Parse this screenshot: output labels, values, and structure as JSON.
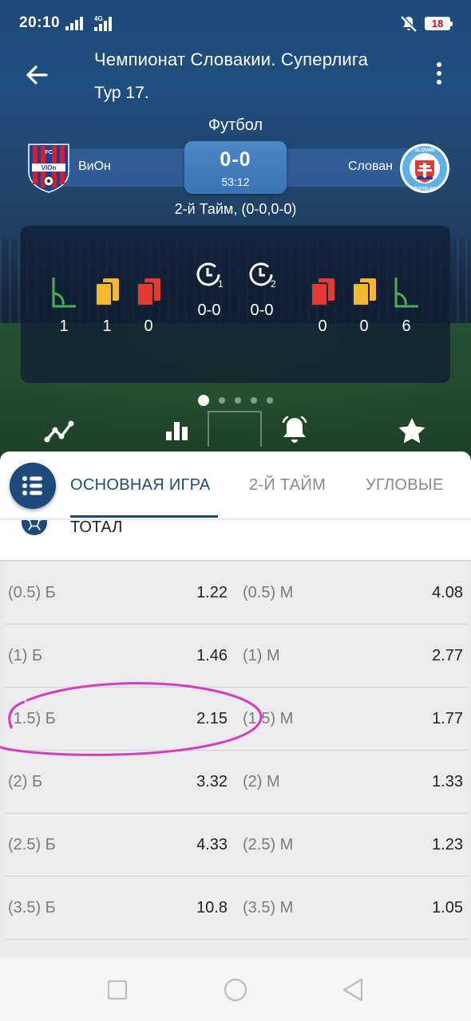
{
  "status_bar": {
    "time": "20:10",
    "network": "4G",
    "battery": "18",
    "battery_color": "#d0021b"
  },
  "header": {
    "back_icon": "arrow-left-icon",
    "title": "Чемпионат Словакии. Суперлига",
    "subtitle": "Тур 17.",
    "more_icon": "more-vertical-icon"
  },
  "match": {
    "sport": "Футбол",
    "home_team": "ВиОн",
    "away_team": "Слован",
    "home_logo_text": "FC ViOn",
    "away_logo_text": "SLOVAN BRATISLAVA",
    "score": "0-0",
    "time": "53:12",
    "half_info": "2-й Тайм, (0-0,0-0)"
  },
  "stats": {
    "home": {
      "corners": "1",
      "yellow_cards": "1",
      "red_cards": "0"
    },
    "away": {
      "red_cards": "0",
      "yellow_cards": "0",
      "corners": "6"
    },
    "periods": [
      {
        "label": "1",
        "score": "0-0"
      },
      {
        "label": "2",
        "score": "0-0"
      }
    ],
    "corner_color": "#4caf50",
    "yellow_color": "#f5b82e",
    "red_color": "#e53935"
  },
  "pager": {
    "count": 5,
    "active": 0
  },
  "actions": [
    "line-chart-icon",
    "bar-chart-icon",
    "bell-icon",
    "star-icon"
  ],
  "tabs": [
    {
      "label": "ОСНОВНАЯ ИГРА",
      "active": true
    },
    {
      "label": "2-Й ТАЙМ",
      "active": false
    },
    {
      "label": "УГЛОВЫЕ",
      "active": false
    }
  ],
  "market": {
    "title": "ТОТАЛ",
    "icon": "soccer-ball-icon",
    "rows": [
      {
        "over_label": "(0.5) Б",
        "over_odd": "1.22",
        "under_label": "(0.5) М",
        "under_odd": "4.08"
      },
      {
        "over_label": "(1) Б",
        "over_odd": "1.46",
        "under_label": "(1) М",
        "under_odd": "2.77"
      },
      {
        "over_label": "(1.5) Б",
        "over_odd": "2.15",
        "under_label": "(1.5) М",
        "under_odd": "1.77"
      },
      {
        "over_label": "(2) Б",
        "over_odd": "3.32",
        "under_label": "(2) М",
        "under_odd": "1.33"
      },
      {
        "over_label": "(2.5) Б",
        "over_odd": "4.33",
        "under_label": "(2.5) М",
        "under_odd": "1.23"
      },
      {
        "over_label": "(3.5) Б",
        "over_odd": "10.8",
        "under_label": "(3.5) М",
        "under_odd": "1.05"
      }
    ]
  },
  "annotation_color": "#d63bc4",
  "accent_color": "#1d4a7a",
  "nav": [
    "recent-apps-icon",
    "home-icon",
    "back-triangle-icon"
  ]
}
